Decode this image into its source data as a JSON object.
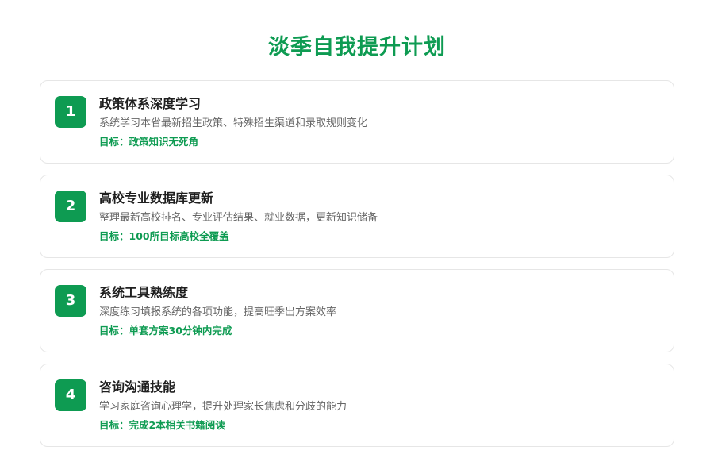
{
  "page": {
    "title": "淡季自我提升计划"
  },
  "colors": {
    "accent": "#0e9b52",
    "title_text": "#1f1f1f",
    "desc_text": "#666666",
    "card_border": "#e6e6e6"
  },
  "plans": [
    {
      "number": "1",
      "title": "政策体系深度学习",
      "description": "系统学习本省最新招生政策、特殊招生渠道和录取规则变化",
      "goal": "目标：政策知识无死角"
    },
    {
      "number": "2",
      "title": "高校专业数据库更新",
      "description": "整理最新高校排名、专业评估结果、就业数据，更新知识储备",
      "goal": "目标：100所目标高校全覆盖"
    },
    {
      "number": "3",
      "title": "系统工具熟练度",
      "description": "深度练习填报系统的各项功能，提高旺季出方案效率",
      "goal": "目标：单套方案30分钟内完成"
    },
    {
      "number": "4",
      "title": "咨询沟通技能",
      "description": "学习家庭咨询心理学，提升处理家长焦虑和分歧的能力",
      "goal": "目标：完成2本相关书籍阅读"
    }
  ]
}
